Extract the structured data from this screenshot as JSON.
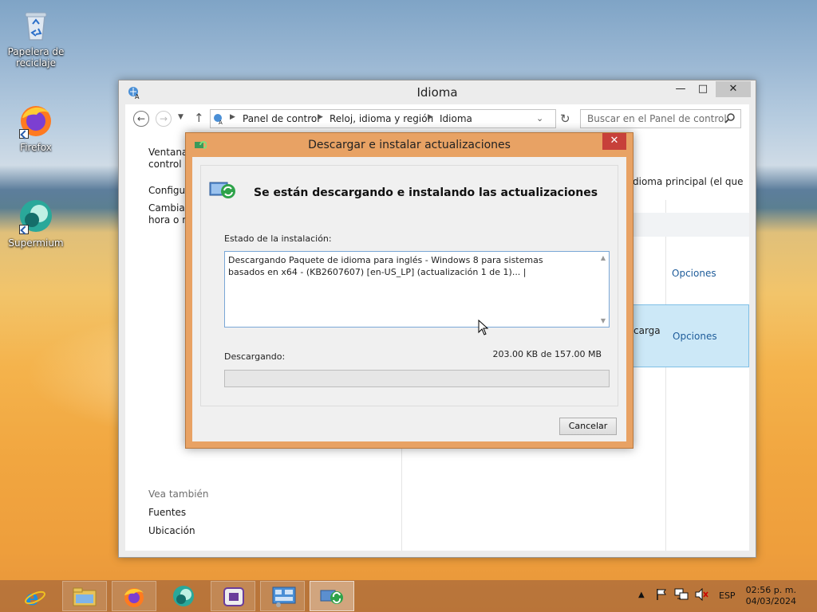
{
  "desktop": {
    "icons": [
      {
        "label": "Papelera de reciclaje"
      },
      {
        "label": "Firefox"
      },
      {
        "label": "Supermium"
      }
    ]
  },
  "cp_window": {
    "title": "Idioma",
    "breadcrumbs": [
      "Panel de control",
      "Reloj, idioma y región",
      "Idioma"
    ],
    "search_placeholder": "Buscar en el Panel de control",
    "left_links": [
      "Ventana",
      "control",
      "Configur",
      "Cambiar",
      "hora o nu"
    ],
    "see_also_title": "Vea también",
    "see_also": [
      "Fuentes",
      "Ubicación"
    ],
    "right_text": "dioma principal (el que",
    "right_text2": "carga",
    "options": [
      "Opciones",
      "Opciones"
    ]
  },
  "dialog": {
    "title": "Descargar e instalar actualizaciones",
    "heading": "Se están descargando e instalando las actualizaciones",
    "status_label": "Estado de la instalación:",
    "status_text": "Descargando Paquete de idioma para inglés - Windows 8 para sistemas basados en x64 - (KB2607607) [en-US_LP] (actualización 1 de 1)... |",
    "downloading_label": "Descargando:",
    "size_text": "203.00 KB de 157.00 MB",
    "progress": 0.0,
    "cancel_label": "Cancelar"
  },
  "taskbar": {
    "tray_lang": "ESP",
    "time": "02:56 p. m.",
    "date": "04/03/2024"
  },
  "colors": {
    "accent": "#e8a264",
    "link": "#1e5c9a",
    "close": "#c7403a"
  }
}
